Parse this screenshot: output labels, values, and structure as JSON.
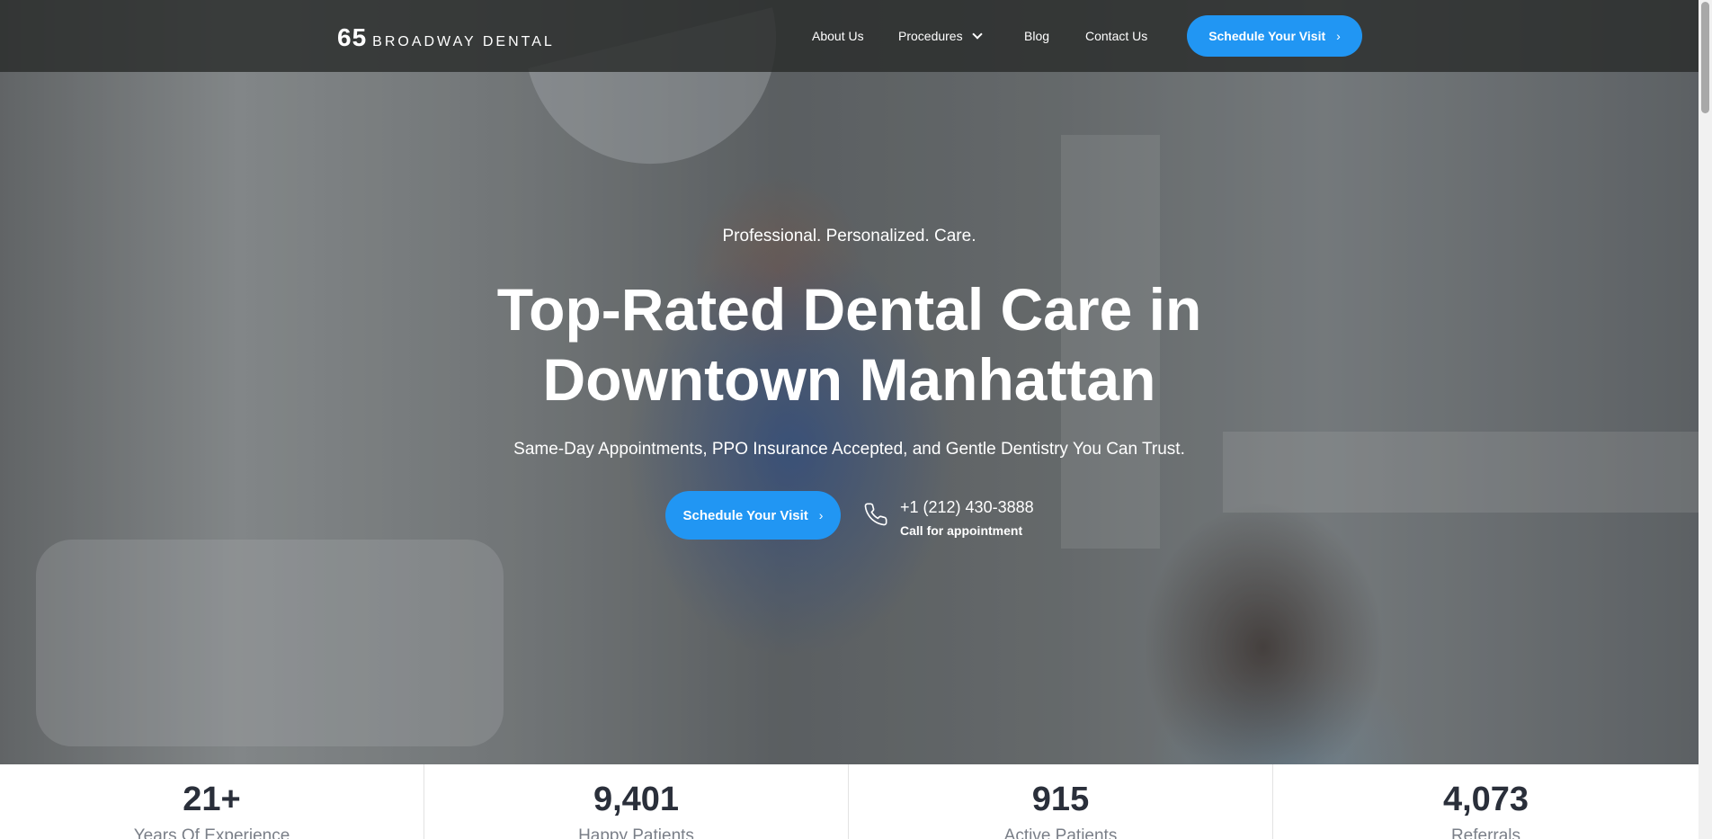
{
  "header": {
    "logo_number": "65",
    "logo_text": "BROADWAY DENTAL",
    "nav": {
      "about": "About Us",
      "procedures": "Procedures",
      "blog": "Blog",
      "contact": "Contact Us"
    },
    "cta": "Schedule Your Visit"
  },
  "hero": {
    "tagline": "Professional. Personalized. Care.",
    "headline_line1": "Top-Rated Dental Care in",
    "headline_line2": "Downtown Manhattan",
    "subhead": "Same-Day Appointments, PPO Insurance Accepted, and Gentle Dentistry You Can Trust.",
    "cta": "Schedule Your Visit",
    "phone_number": "+1 (212) 430-3888",
    "phone_caption": "Call for appointment"
  },
  "stats": [
    {
      "value": "21+",
      "label": "Years Of Experience"
    },
    {
      "value": "9,401",
      "label": "Happy Patients"
    },
    {
      "value": "915",
      "label": "Active Patients"
    },
    {
      "value": "4,073",
      "label": "Referrals"
    }
  ],
  "icons": {
    "nav_dropdown": "chevron-down-icon",
    "button_arrow": "chevron-right-icon",
    "phone": "phone-icon"
  },
  "colors": {
    "accent": "#2196f3",
    "header_bg": "#2a2c2b",
    "stat_value": "#2a2f3a",
    "stat_label": "#7a7f88"
  }
}
